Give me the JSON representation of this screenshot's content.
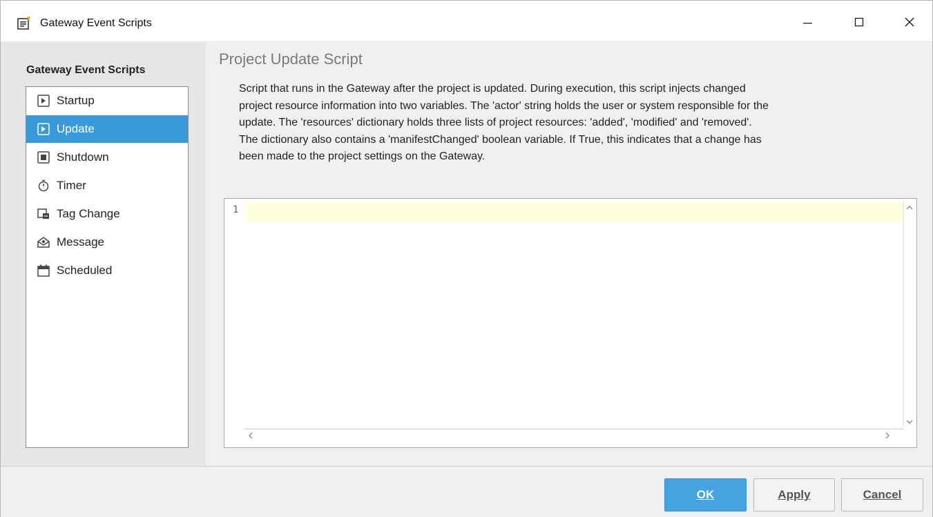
{
  "window": {
    "title": "Gateway Event Scripts",
    "icon": "script-window-icon",
    "controls": {
      "minimize": "minimize-icon",
      "maximize": "maximize-icon",
      "close": "close-icon"
    }
  },
  "sidebar": {
    "title": "Gateway Event Scripts",
    "selected_index": 1,
    "items": [
      {
        "label": "Startup",
        "icon": "startup-icon"
      },
      {
        "label": "Update",
        "icon": "update-icon"
      },
      {
        "label": "Shutdown",
        "icon": "shutdown-icon"
      },
      {
        "label": "Timer",
        "icon": "timer-icon"
      },
      {
        "label": "Tag Change",
        "icon": "tag-change-icon"
      },
      {
        "label": "Message",
        "icon": "message-icon"
      },
      {
        "label": "Scheduled",
        "icon": "scheduled-icon"
      }
    ]
  },
  "main": {
    "heading": "Project Update Script",
    "description_lines": [
      "Script that runs in the Gateway after the project is updated. During execution, this script injects changed",
      "project resource information into two variables. The 'actor' string holds the user or system responsible for the",
      "update. The 'resources' dictionary holds three lists of project resources: 'added', 'modified' and 'removed'.",
      "The dictionary also contains a 'manifestChanged' boolean variable. If True, this indicates that a change has",
      "been made to the project settings on the Gateway."
    ],
    "editor": {
      "line_numbers": [
        "1"
      ],
      "content": ""
    }
  },
  "footer": {
    "ok_label": "OK",
    "apply_label": "Apply",
    "cancel_label": "Cancel"
  },
  "colors": {
    "selection": "#3a9ad9",
    "primary_button": "#47a3e0",
    "current_line": "#ffffdd",
    "heading": "#7a7a7a",
    "line_number": "#b04040"
  }
}
